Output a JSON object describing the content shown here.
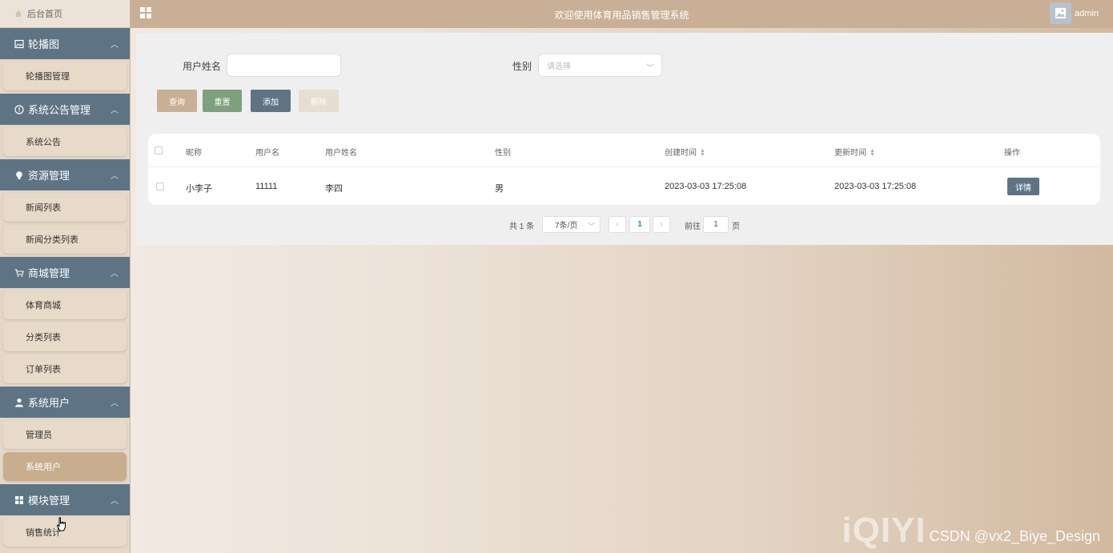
{
  "sidebar": {
    "home": "后台首页",
    "groups": [
      {
        "label": "轮播图",
        "icon": "image-icon",
        "items": [
          {
            "label": "轮播图管理"
          }
        ]
      },
      {
        "label": "系统公告管理",
        "icon": "info-circle-icon",
        "items": [
          {
            "label": "系统公告"
          }
        ]
      },
      {
        "label": "资源管理",
        "icon": "lightbulb-icon",
        "items": [
          {
            "label": "新闻列表"
          },
          {
            "label": "新闻分类列表"
          }
        ]
      },
      {
        "label": "商城管理",
        "icon": "cart-icon",
        "items": [
          {
            "label": "体育商城"
          },
          {
            "label": "分类列表"
          },
          {
            "label": "订单列表"
          }
        ]
      },
      {
        "label": "系统用户",
        "icon": "user-icon",
        "items": [
          {
            "label": "管理员"
          },
          {
            "label": "系统用户",
            "active": true
          }
        ]
      },
      {
        "label": "模块管理",
        "icon": "grid-icon",
        "items": [
          {
            "label": "销售统计"
          }
        ]
      }
    ]
  },
  "header": {
    "title": "欢迎使用体育用品销售管理系统",
    "username": "admin"
  },
  "search": {
    "name_label": "用户姓名",
    "name_value": "",
    "gender_label": "性别",
    "gender_placeholder": "请选择"
  },
  "buttons": {
    "query": "查询",
    "reset": "重置",
    "add": "添加",
    "delete": "删除"
  },
  "table": {
    "headers": {
      "nickname": "昵称",
      "username": "用户名",
      "realname": "用户姓名",
      "gender": "性别",
      "created": "创建时间",
      "updated": "更新时间",
      "actions": "操作"
    },
    "rows": [
      {
        "nickname": "小李子",
        "username": "11111",
        "realname": "李四",
        "gender": "男",
        "created": "2023-03-03 17:25:08",
        "updated": "2023-03-03 17:25:08",
        "action": "详情"
      }
    ]
  },
  "pagination": {
    "total": "共 1 条",
    "page_size": "7条/页",
    "current_page": "1",
    "goto_label": "前往",
    "goto_value": "1",
    "page_suffix": "页"
  },
  "watermark": {
    "brand": "iQIYI",
    "credit": "CSDN @vx2_Biye_Design"
  },
  "colors": {
    "sidebar_group": "#5e7485",
    "header": "#c9af95",
    "btn_query": "#c9af95",
    "btn_reset": "#7f9f7f",
    "btn_add": "#5e7485",
    "btn_delete": "#e8ddd2"
  }
}
